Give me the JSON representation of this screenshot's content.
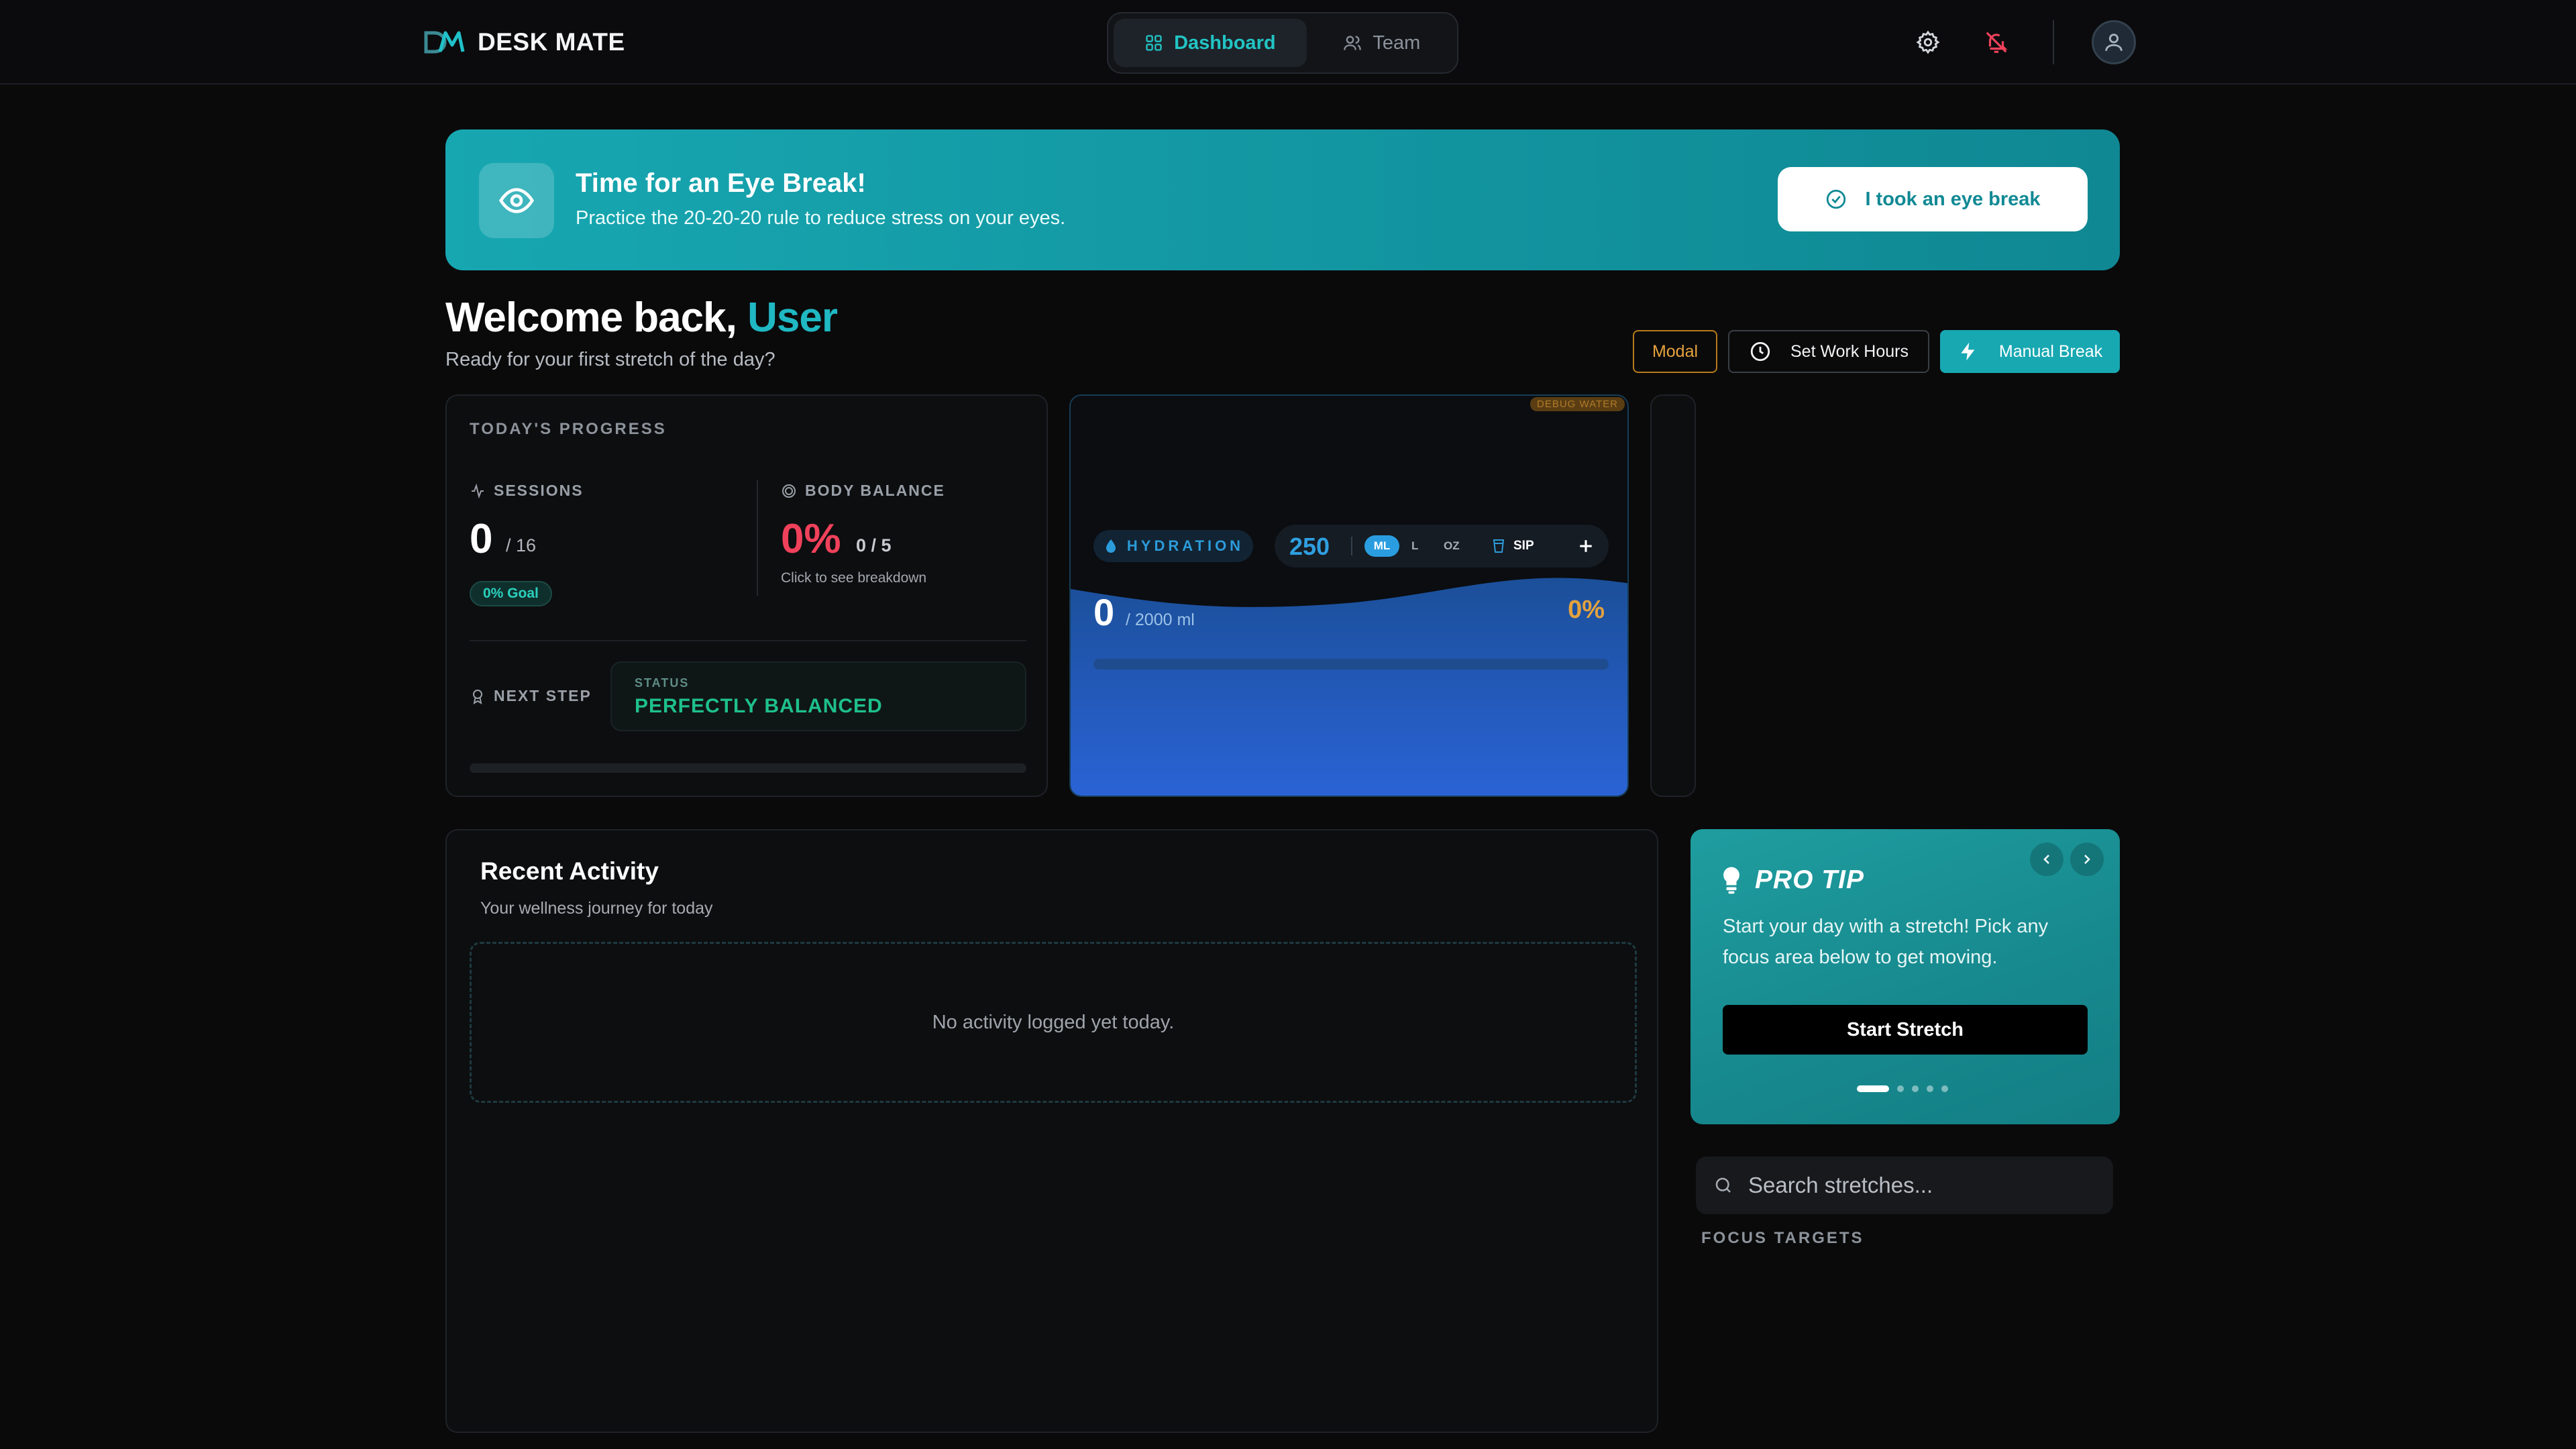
{
  "app": {
    "name": "DESK MATE"
  },
  "nav": {
    "tabs": [
      {
        "label": "Dashboard"
      },
      {
        "label": "Team"
      }
    ]
  },
  "banner": {
    "title": "Time for an Eye Break!",
    "subtitle": "Practice the 20-20-20 rule to reduce stress on your eyes.",
    "button": "I took an eye break"
  },
  "welcome": {
    "greeting": "Welcome back,",
    "name": "User",
    "subtitle": "Ready for your first stretch of the day?"
  },
  "actions": {
    "modal": "Modal",
    "work_hours": "Set Work Hours",
    "manual_break": "Manual Break"
  },
  "progress": {
    "title": "TODAY'S PROGRESS",
    "sessions": {
      "label": "SESSIONS",
      "value": "0",
      "of": "/ 16",
      "goal_badge": "0% Goal"
    },
    "balance": {
      "label": "BODY BALANCE",
      "value": "0%",
      "of": "0 / 5",
      "hint": "Click to see breakdown"
    },
    "next_step": {
      "label": "NEXT STEP",
      "status_label": "STATUS",
      "status_value": "PERFECTLY BALANCED"
    }
  },
  "hydration": {
    "debug_tag": "DEBUG WATER",
    "label": "HYDRATION",
    "amount": "250",
    "units": [
      "ML",
      "L",
      "OZ"
    ],
    "selected_unit": "ML",
    "sip_label": "SIP",
    "current": "0",
    "goal": "/ 2000 ml",
    "percent": "0%",
    "progress": 0
  },
  "activity": {
    "title": "Recent Activity",
    "subtitle": "Your wellness journey for today",
    "empty": "No activity logged yet today."
  },
  "protip": {
    "title": "PRO TIP",
    "body": "Start your day with a stretch! Pick any focus area below to get moving.",
    "button": "Start Stretch",
    "slide_count": 5,
    "active_slide": 1
  },
  "search": {
    "placeholder": "Search stretches..."
  },
  "focus": {
    "label": "FOCUS TARGETS"
  },
  "colors": {
    "accent": "#1fb8c3",
    "danger": "#f0415b",
    "success": "#1ec08a",
    "warning": "#e3a23e",
    "water": "#2a9de0"
  }
}
